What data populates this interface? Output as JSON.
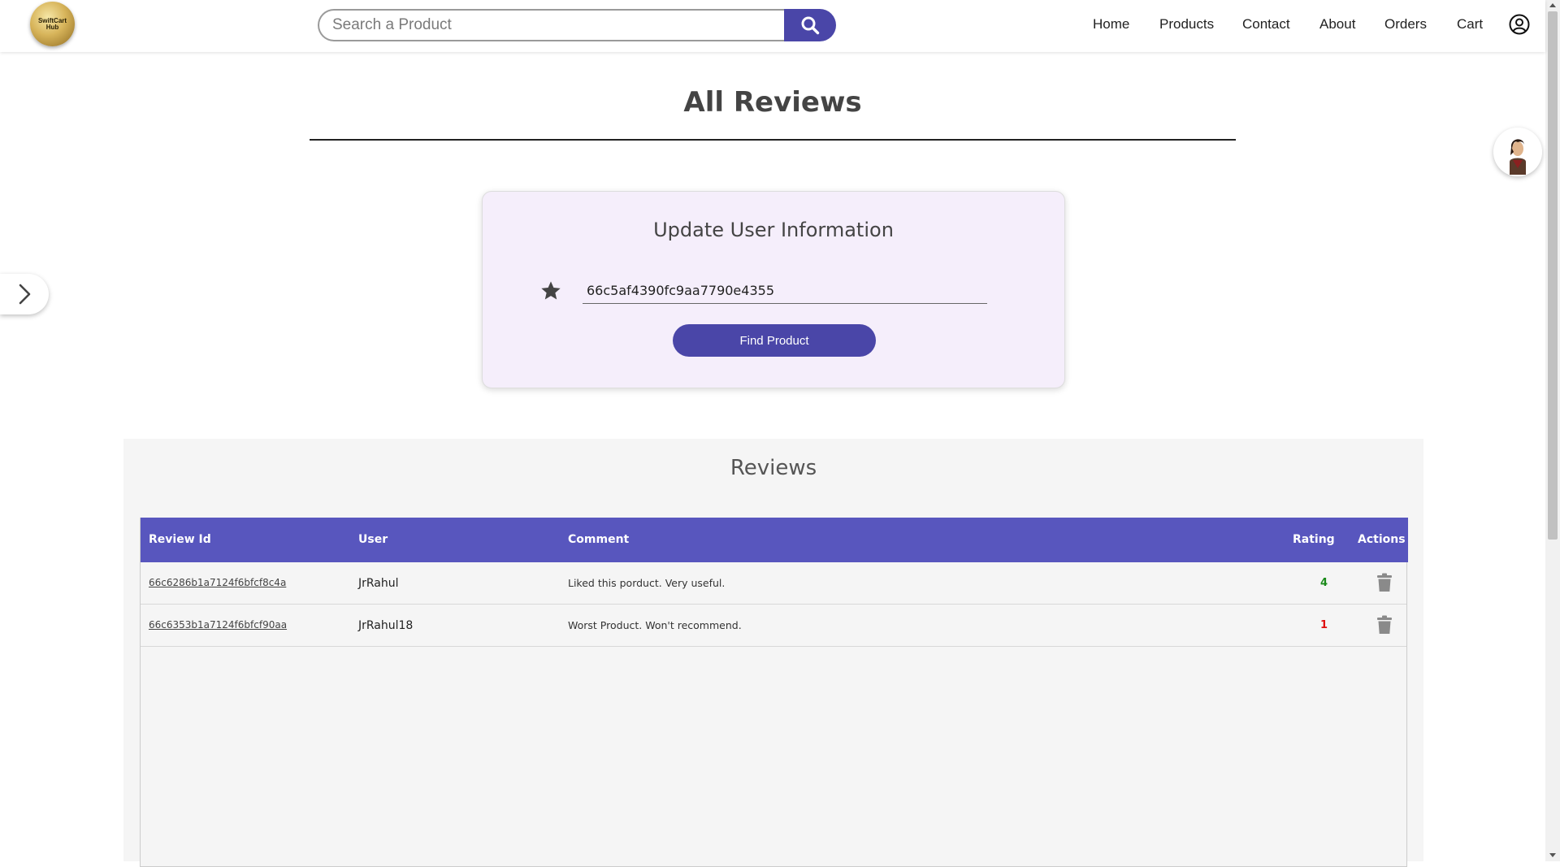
{
  "header": {
    "logo_text": "SwiftCart Hub",
    "search_placeholder": "Search a Product",
    "nav": [
      "Home",
      "Products",
      "Contact",
      "About",
      "Orders",
      "Cart"
    ]
  },
  "page": {
    "title": "All Reviews"
  },
  "card": {
    "title": "Update User Information",
    "product_id_value": "66c5af4390fc9aa7790e4355",
    "button_label": "Find Product"
  },
  "reviews": {
    "title": "Reviews",
    "columns": [
      "Review Id",
      "User",
      "Comment",
      "Rating",
      "Actions"
    ],
    "rows": [
      {
        "id": "66c6286b1a7124f6bfcf8c4a",
        "user": "JrRahul",
        "comment": "Liked this porduct. Very useful.",
        "rating": "4",
        "rating_color": "#1a8a1a"
      },
      {
        "id": "66c6353b1a7124f6bfcf90aa",
        "user": "JrRahul18",
        "comment": "Worst Product. Won't recommend.",
        "rating": "1",
        "rating_color": "#e01010"
      }
    ]
  },
  "colors": {
    "accent": "#4a46a8",
    "table_header": "#5856be",
    "card_bg": "#f5eefb"
  }
}
